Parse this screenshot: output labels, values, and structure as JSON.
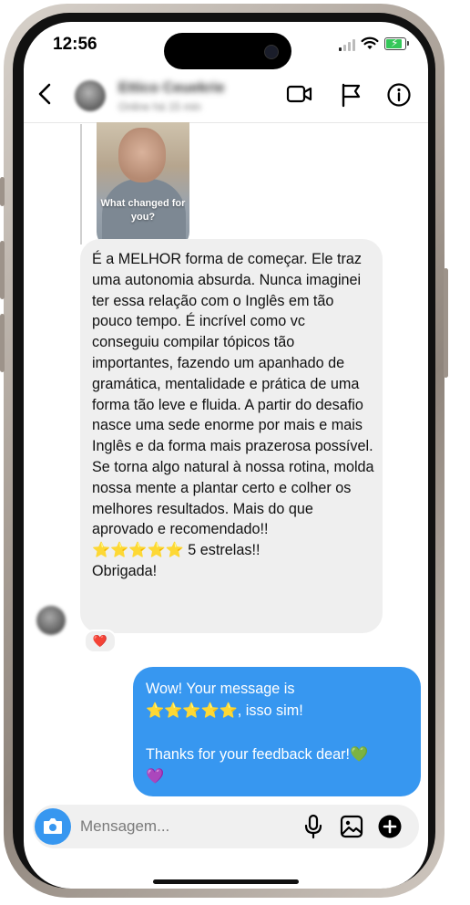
{
  "status_bar": {
    "time": "12:56"
  },
  "header": {
    "contact_name": "Ettico Ceuekrie",
    "contact_status": "Online há 15 min"
  },
  "story_reply": {
    "caption": "What changed for you?"
  },
  "messages": {
    "incoming": "É a MELHOR forma de começar. Ele traz uma autonomia absurda. Nunca imaginei ter essa relação com o Inglês em tão pouco tempo. É incrível como vc conseguiu compilar tópicos tão importantes, fazendo um apanhado de gramática, mentalidade e prática de uma forma tão leve e fluida. A partir do desafio nasce uma sede enorme por mais e mais Inglês e da forma mais prazerosa possível. Se torna algo natural à nossa rotina, molda nossa mente a plantar certo e colher os melhores resultados. Mais do que aprovado e recomendado!!\n⭐⭐⭐⭐⭐ 5 estrelas!!\nObrigada!",
    "incoming_reaction": "❤️",
    "outgoing": "Wow! Your message is\n⭐⭐⭐⭐⭐, isso sim!\n\nThanks for your feedback dear!💚\n💜"
  },
  "composer": {
    "placeholder": "Mensagem..."
  },
  "icons": [
    "back-chevron-icon",
    "video-call-icon",
    "flag-icon",
    "info-icon",
    "camera-icon",
    "microphone-icon",
    "gallery-icon",
    "plus-icon"
  ],
  "colors": {
    "outgoing_bubble": "#3797f0",
    "incoming_bubble": "#efefef",
    "battery": "#34c759"
  }
}
